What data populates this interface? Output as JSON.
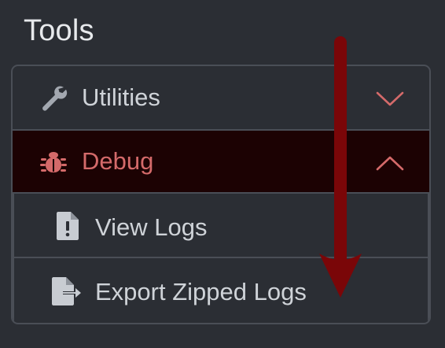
{
  "section_title": "Tools",
  "accordion": {
    "items": [
      {
        "label": "Utilities",
        "icon": "wrench-icon",
        "state": "collapsed"
      },
      {
        "label": "Debug",
        "icon": "bug-icon",
        "state": "expanded"
      }
    ],
    "debug_children": [
      {
        "label": "View Logs",
        "icon": "file-warning-icon"
      },
      {
        "label": "Export Zipped Logs",
        "icon": "file-export-icon"
      }
    ]
  },
  "colors": {
    "background": "#2b2e34",
    "border": "#4a4e56",
    "active_row_bg": "#1c0203",
    "active_text": "#d46a6a",
    "text": "#cfd3d8",
    "annotation_arrow": "#7a0608"
  }
}
